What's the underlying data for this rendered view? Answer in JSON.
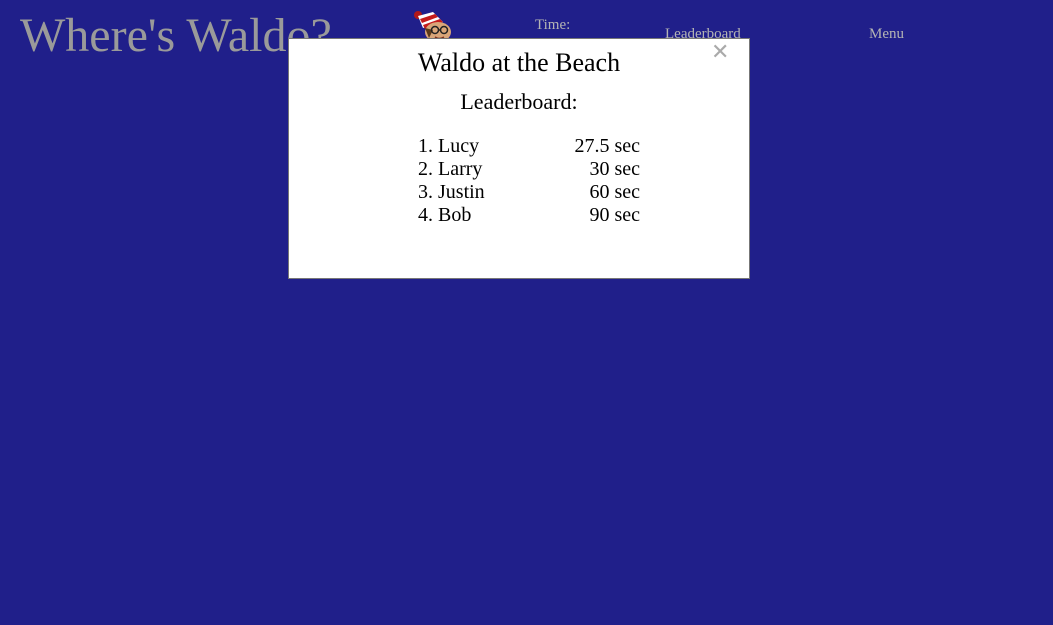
{
  "header": {
    "title": "Where's Waldo?",
    "avatar_icon": "waldo-head-icon",
    "timer_label": "Time:",
    "nav_leaderboard": "Leaderboard",
    "nav_menu": "Menu"
  },
  "modal": {
    "title": "Waldo at the Beach",
    "subtitle": "Leaderboard:",
    "close_icon": "close-icon",
    "entries": [
      {
        "rank": "1. Lucy",
        "time": "27.5 sec"
      },
      {
        "rank": "2. Larry",
        "time": "30 sec"
      },
      {
        "rank": "3. Justin",
        "time": "60 sec"
      },
      {
        "rank": "4. Bob",
        "time": "90 sec"
      }
    ]
  },
  "colors": {
    "background": "#201f8a",
    "header_text": "#9a9a9a",
    "modal_bg": "#ffffff"
  }
}
